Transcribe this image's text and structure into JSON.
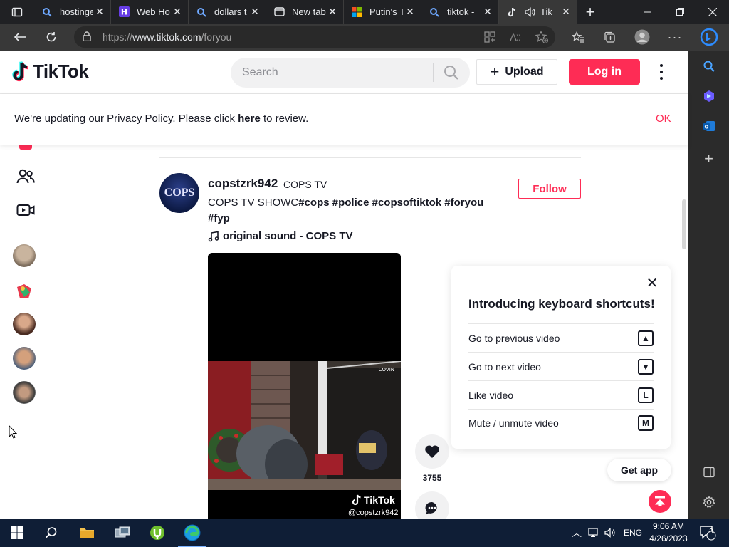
{
  "browser": {
    "tabs": [
      {
        "title": "hostinge",
        "icon": "search-icon"
      },
      {
        "title": "Web Ho",
        "icon": "hostinger-icon"
      },
      {
        "title": "dollars t",
        "icon": "search-icon"
      },
      {
        "title": "New tab",
        "icon": "newtab-icon"
      },
      {
        "title": "Putin's T",
        "icon": "microsoft-icon"
      },
      {
        "title": "tiktok -",
        "icon": "search-icon"
      },
      {
        "title": "Tik",
        "icon": "tiktok-icon"
      }
    ],
    "url_prefix": "https://",
    "url_domain": "www.tiktok.com",
    "url_path": "/foryou"
  },
  "header": {
    "brand": "TikTok",
    "search_placeholder": "Search",
    "upload_label": "Upload",
    "login_label": "Log in"
  },
  "privacy": {
    "text_before": "We're updating our Privacy Policy. Please click ",
    "link": "here",
    "text_after": " to review.",
    "ok": "OK"
  },
  "post": {
    "username": "copstzrk942",
    "nickname": "COPS TV",
    "avatar_text": "COPS",
    "caption_text": "COPS TV SHOWC",
    "caption_tags": "#cops #police #copsoftiktok #foryou #fyp",
    "music": "original sound - COPS TV",
    "follow_label": "Follow",
    "watermark_brand": "TikTok",
    "watermark_user": "@copstzrk942",
    "like_count": "3755"
  },
  "shortcuts": {
    "title": "Introducing keyboard shortcuts!",
    "items": [
      {
        "label": "Go to previous video",
        "key": "▲"
      },
      {
        "label": "Go to next video",
        "key": "▼"
      },
      {
        "label": "Like video",
        "key": "L"
      },
      {
        "label": "Mute / unmute video",
        "key": "M"
      }
    ]
  },
  "get_app_label": "Get app",
  "taskbar": {
    "lang": "ENG",
    "time": "9:06 AM",
    "date": "4/26/2023",
    "notifications": "3"
  },
  "colors": {
    "brand_red": "#fe2c55",
    "text_dark": "#161823",
    "taskbar": "#0f1e36"
  }
}
